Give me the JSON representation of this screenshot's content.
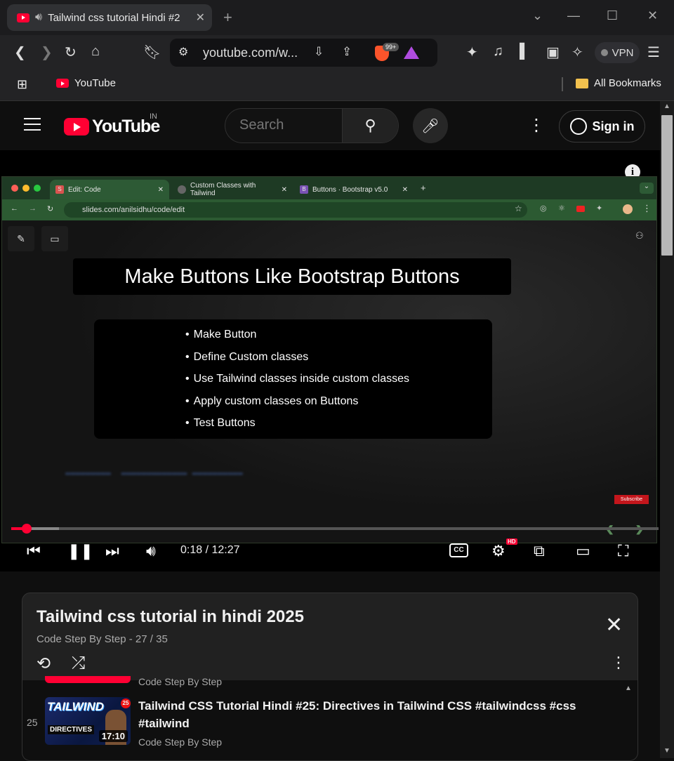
{
  "browser": {
    "tab_title": "Tailwind css tutorial Hindi #2",
    "url": "youtube.com/w...",
    "shields_badge": "99+",
    "vpn_label": "VPN",
    "bookmarks": {
      "youtube": "YouTube",
      "all": "All Bookmarks"
    }
  },
  "header": {
    "logo_text": "YouTube",
    "country": "IN",
    "search_placeholder": "Search",
    "signin_label": "Sign in"
  },
  "video": {
    "inner_tabs": [
      {
        "label": "Edit: Code",
        "fav": "S"
      },
      {
        "label": "Custom Classes with Tailwind"
      },
      {
        "label": "Buttons · Bootstrap v5.0",
        "fav": "B"
      }
    ],
    "inner_url": "slides.com/anilsidhu/code/edit",
    "slide_title": "Make Buttons Like Bootstrap Buttons",
    "slide_points": [
      "Make Button",
      "Define Custom classes",
      "Use Tailwind classes inside custom classes",
      "Apply custom classes on Buttons",
      "Test Buttons"
    ],
    "subscribe_label": "Subscribe",
    "time": "0:18 / 12:27",
    "progress_fraction": 0.024,
    "buffered_fraction": 0.074,
    "cc_label": "CC",
    "hd_label": "HD"
  },
  "playlist": {
    "title": "Tailwind css tutorial in hindi 2025",
    "subtitle": "Code Step By Step - 27 / 35",
    "prev_channel": "Code Step By Step",
    "item": {
      "index": "25",
      "title": "Tailwind CSS Tutorial Hindi #25: Directives in Tailwind CSS #tailwindcss #css #tailwind",
      "channel": "Code Step By Step",
      "duration": "17:10",
      "thumb_title": "TAILWIND",
      "thumb_sub": "DIRECTIVES",
      "thumb_num": "25"
    }
  },
  "colors": {
    "accent": "#ff0033",
    "background": "#0f0f0f",
    "panel": "#212121"
  }
}
